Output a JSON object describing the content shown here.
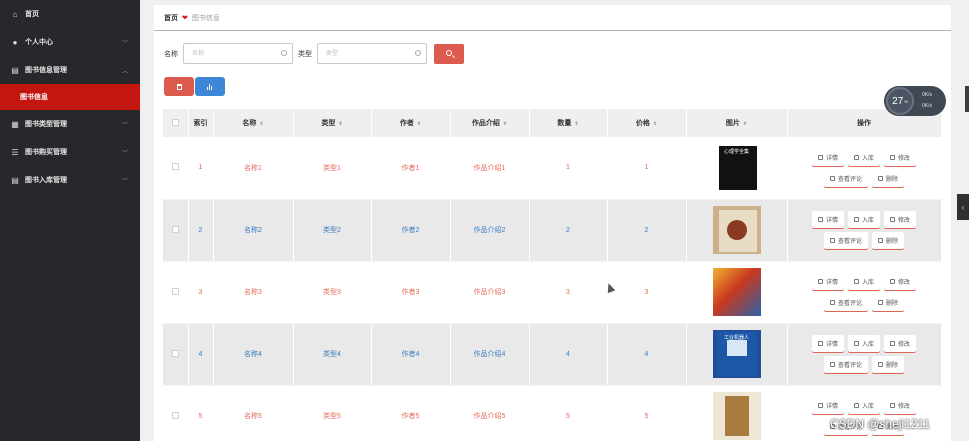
{
  "sidebar": {
    "items": [
      {
        "label": "首页",
        "icon": "home-icon"
      },
      {
        "label": "个人中心",
        "icon": "user-icon"
      },
      {
        "label": "图书信息管理",
        "icon": "book-icon"
      },
      {
        "label": "图书信息",
        "icon": ""
      },
      {
        "label": "图书类型管理",
        "icon": "grid-icon"
      },
      {
        "label": "图书购买管理",
        "icon": "sliders-icon"
      },
      {
        "label": "图书入库管理",
        "icon": "book-icon"
      }
    ]
  },
  "breadcrumb": {
    "home": "首页",
    "current": "图书信息"
  },
  "search": {
    "name_label": "名称",
    "name_placeholder": "名称",
    "type_label": "类型",
    "type_placeholder": "类型"
  },
  "table": {
    "headers": [
      "索引",
      "名称",
      "类型",
      "作者",
      "作品介绍",
      "数量",
      "价格",
      "图片",
      "操作"
    ],
    "rows": [
      {
        "index": "1",
        "name": "名称1",
        "type": "类型1",
        "author": "作者1",
        "intro": "作品介绍1",
        "qty": "1",
        "price": "1",
        "cover_text": "心理学全集"
      },
      {
        "index": "2",
        "name": "名称2",
        "type": "类型2",
        "author": "作者2",
        "intro": "作品介绍2",
        "qty": "2",
        "price": "2",
        "cover_text": ""
      },
      {
        "index": "3",
        "name": "名称3",
        "type": "类型3",
        "author": "作者3",
        "intro": "作品介绍3",
        "qty": "3",
        "price": "3",
        "cover_text": ""
      },
      {
        "index": "4",
        "name": "名称4",
        "type": "类型4",
        "author": "作者4",
        "intro": "作品介绍4",
        "qty": "4",
        "price": "4",
        "cover_text": "工业机器人"
      },
      {
        "index": "5",
        "name": "名称5",
        "type": "类型5",
        "author": "作者5",
        "intro": "作品介绍5",
        "qty": "5",
        "price": "5",
        "cover_text": ""
      }
    ],
    "ops": [
      "详情",
      "入库",
      "修改",
      "查看评论",
      "删除"
    ]
  },
  "perf": {
    "value": "27",
    "unit": "%",
    "up": "0K/s",
    "down": "0K/s"
  },
  "watermark": "CSDN @shejі1211",
  "colors": {
    "sidebar": "#26282b",
    "active": "#c2160f",
    "danger": "#dd5a4e",
    "primary": "#3d87d6"
  }
}
